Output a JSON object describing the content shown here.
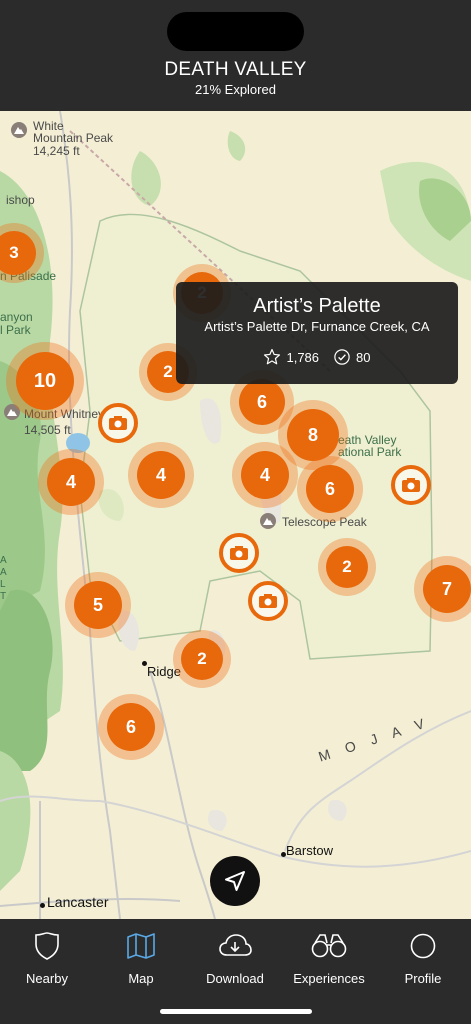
{
  "header": {
    "title": "DEATH VALLEY",
    "subtitle": "21% Explored"
  },
  "map_labels": {
    "white_mountain": "White",
    "white_mountain2": "Mountain Peak",
    "white_mountain_elev": "14,245 ft",
    "bishop": "ishop",
    "palisade": "n Palisade",
    "canyon": "anyon",
    "park": "l Park",
    "whitney": "Mount Whitney",
    "whitney_elev": "14,505 ft",
    "dv_np": "eath Valley",
    "dv_np2": "ational Park",
    "telescope": "Telescope Peak",
    "ridge": "Ridge",
    "barstow": "Barstow",
    "lancaster": "Lancaster",
    "mojave": "M O J A V",
    "edge1": "A",
    "edge2": "A",
    "edge3": "L",
    "edge4": "T"
  },
  "clusters": [
    "3",
    "2",
    "10",
    "2",
    "6",
    "8",
    "4",
    "4",
    "4",
    "6",
    "2",
    "7",
    "5",
    "2",
    "6"
  ],
  "popup": {
    "title": "Artist’s Palette",
    "address": "Artist’s Palette Dr, Furnance Creek, CA",
    "favorites": "1,786",
    "checkins": "80"
  },
  "tabs": [
    {
      "label": "Nearby",
      "icon": "shield-icon"
    },
    {
      "label": "Map",
      "icon": "map-icon"
    },
    {
      "label": "Download",
      "icon": "cloud-download-icon"
    },
    {
      "label": "Experiences",
      "icon": "binoculars-icon"
    },
    {
      "label": "Profile",
      "icon": "profile-icon"
    }
  ],
  "colors": {
    "accent": "#e8680c",
    "bar": "#2b2b2b",
    "map": "#f4efd4",
    "active_tab": "#5aa9e6"
  }
}
